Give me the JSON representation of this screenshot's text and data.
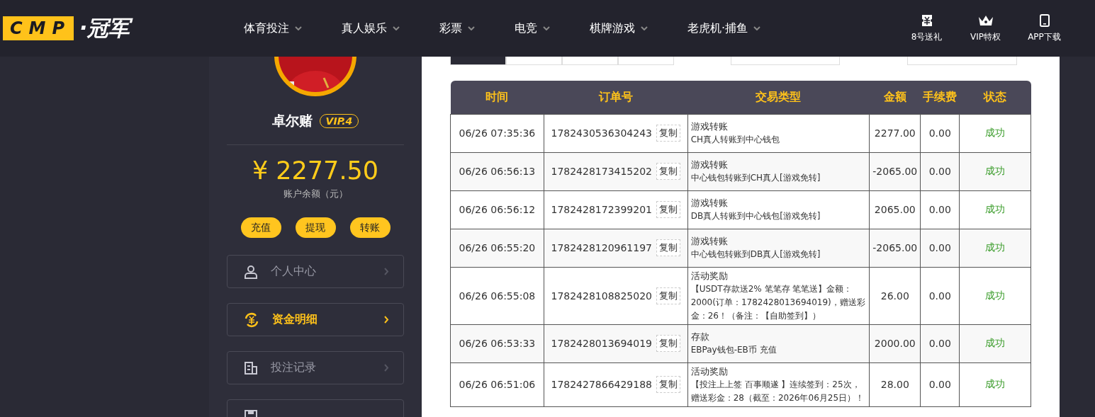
{
  "header": {
    "logo": {
      "badge": "CMP",
      "name": "·冠军"
    },
    "nav": [
      {
        "label": "体育投注"
      },
      {
        "label": "真人娱乐"
      },
      {
        "label": "彩票"
      },
      {
        "label": "电竞"
      },
      {
        "label": "棋牌游戏"
      },
      {
        "label": "老虎机·捕鱼"
      }
    ],
    "actions": [
      {
        "kind": "ticket",
        "label": "8号送礼"
      },
      {
        "kind": "crown",
        "label": "VIP特权"
      },
      {
        "kind": "phone",
        "label": "APP下载"
      }
    ]
  },
  "profile": {
    "avatar": {
      "kind": "picture"
    },
    "name": "卓尔赌",
    "vip": "VIP.4",
    "balance": "¥ 2277.50",
    "balance_label": "账户余额（元）",
    "buttons": [
      "充值",
      "提现",
      "转账"
    ]
  },
  "menu": [
    {
      "kind": "user",
      "label": "个人中心",
      "selected": false
    },
    {
      "kind": "money",
      "label": "资金明细",
      "selected": true
    },
    {
      "kind": "record",
      "label": "投注记录",
      "selected": false
    },
    {
      "kind": "save",
      "selected": false
    }
  ],
  "filters": {
    "tabs": [
      {
        "selected": true
      },
      {
        "selected": false
      },
      {
        "selected": false
      },
      {
        "selected": false
      }
    ]
  },
  "table": {
    "columns": [
      "时间",
      "订单号",
      "交易类型",
      "金额",
      "手续费",
      "状态"
    ],
    "rows": [
      {
        "time": "06/26 07:35:36",
        "order": "1782430536304243",
        "copy": "复制",
        "type": "游戏转账",
        "detail": "CH真人转账到中心钱包",
        "amount": "2277.00",
        "fee": "0.00",
        "status": "成功"
      },
      {
        "time": "06/26 06:56:13",
        "order": "1782428173415202",
        "copy": "复制",
        "type": "游戏转账",
        "detail": "中心钱包转账到CH真人[游戏免转]",
        "amount": "-2065.00",
        "fee": "0.00",
        "status": "成功"
      },
      {
        "time": "06/26 06:56:12",
        "order": "1782428172399201",
        "copy": "复制",
        "type": "游戏转账",
        "detail": "DB真人转账到中心钱包[游戏免转]",
        "amount": "2065.00",
        "fee": "0.00",
        "status": "成功"
      },
      {
        "time": "06/26 06:55:20",
        "order": "1782428120961197",
        "copy": "复制",
        "type": "游戏转账",
        "detail": "中心钱包转账到DB真人[游戏免转]",
        "amount": "-2065.00",
        "fee": "0.00",
        "status": "成功"
      },
      {
        "time": "06/26 06:55:08",
        "order": "1782428108825020",
        "copy": "复制",
        "type": "活动奖励",
        "detail": "【USDT存款送2% 笔笔存 笔笔送】金额：2000(订单：1782428013694019)，赠送彩金：26！（备注：【自助签到】）",
        "amount": "26.00",
        "fee": "0.00",
        "status": "成功"
      },
      {
        "time": "06/26 06:53:33",
        "order": "1782428013694019",
        "copy": "复制",
        "type": "存款",
        "detail": "EBPay钱包-EB币 充值",
        "amount": "2000.00",
        "fee": "0.00",
        "status": "成功"
      },
      {
        "time": "06/26 06:51:06",
        "order": "1782427866429188",
        "copy": "复制",
        "type": "活动奖励",
        "detail": "【投注上上签 百事顺遂 】连续签到：25次，赠送彩金：28（截至：2026年06月25日）！",
        "amount": "28.00",
        "fee": "0.00",
        "status": "成功"
      }
    ]
  }
}
